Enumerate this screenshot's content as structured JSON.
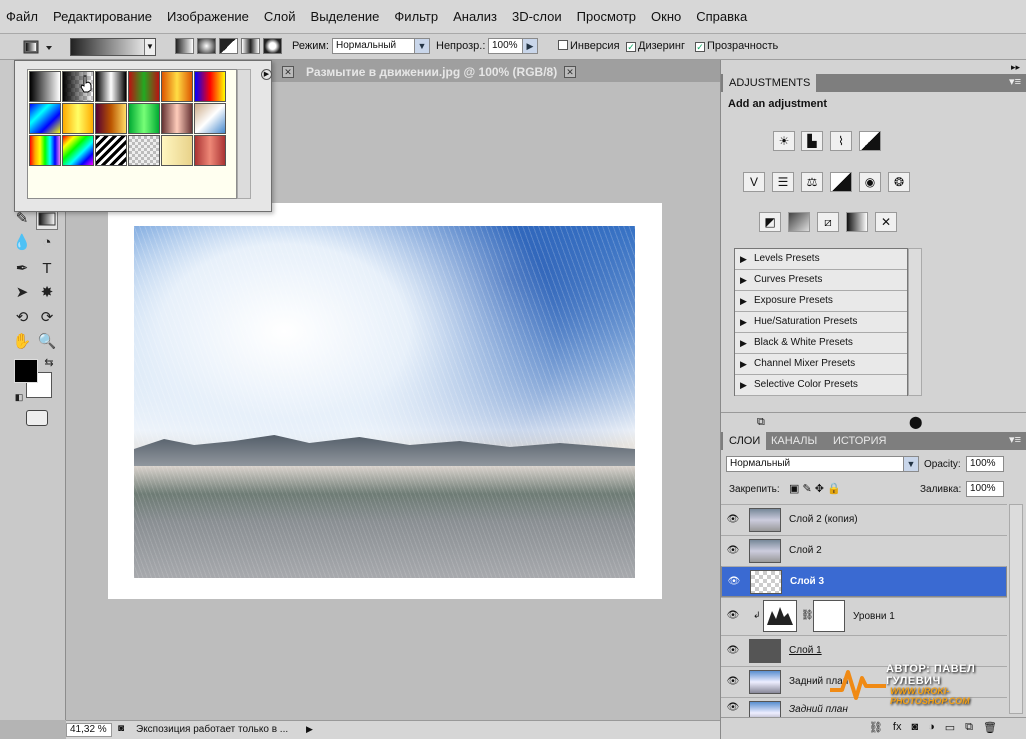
{
  "menu": [
    "Файл",
    "Редактирование",
    "Изображение",
    "Слой",
    "Выделение",
    "Фильтр",
    "Анализ",
    "3D-слои",
    "Просмотр",
    "Окно",
    "Справка"
  ],
  "options": {
    "mode_label": "Режим:",
    "mode_value": "Нормальный",
    "opacity_label": "Непрозр.:",
    "opacity_value": "100%",
    "reverse_label": "Инверсия",
    "dither_label": "Дизеринг",
    "transparency_label": "Прозрачность",
    "reverse_checked": false,
    "dither_checked": true,
    "transparency_checked": true
  },
  "document": {
    "tab_title": "Размытие в движении.jpg @ 100% (RGB/8)"
  },
  "status": {
    "zoom": "41,32 %",
    "info": "Экспозиция работает только в ..."
  },
  "adjustments": {
    "tab": "ADJUSTMENTS",
    "title": "Add an adjustment",
    "presets": [
      "Levels Presets",
      "Curves Presets",
      "Exposure Presets",
      "Hue/Saturation Presets",
      "Black & White Presets",
      "Channel Mixer Presets",
      "Selective Color Presets"
    ]
  },
  "layers_panel": {
    "tabs": [
      "СЛОИ",
      "КАНАЛЫ",
      "ИСТОРИЯ"
    ],
    "blend_mode": "Нормальный",
    "opacity_label": "Opacity:",
    "opacity_value": "100%",
    "lock_label": "Закрепить:",
    "fill_label": "Заливка:",
    "fill_value": "100%",
    "layers": [
      {
        "name": "Слой 2 (копия)",
        "selected": false
      },
      {
        "name": "Слой 2",
        "selected": false
      },
      {
        "name": "Слой 3",
        "selected": true
      },
      {
        "name": "Уровни 1",
        "selected": false
      },
      {
        "name": "Слой 1",
        "selected": false
      },
      {
        "name": "Задний план",
        "selected": false
      },
      {
        "name": "Задний план",
        "selected": false
      }
    ]
  },
  "watermark": {
    "author": "АВТОР: ПАВЕЛ ГУЛЕВИЧ",
    "site": "WWW.UROKI-PHOTOSHOP.COM"
  },
  "colors": {
    "foreground": "#000000",
    "background": "#ffffff",
    "selection": "#3a6ad2"
  }
}
